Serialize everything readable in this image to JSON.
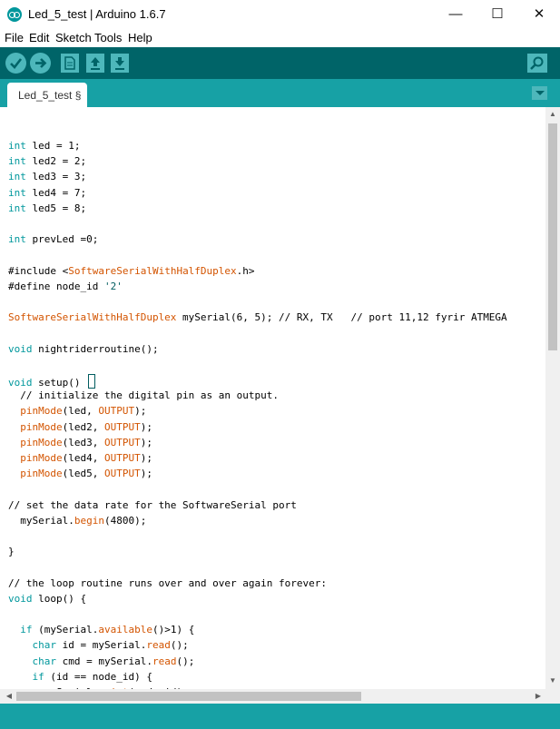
{
  "window": {
    "title": "Led_5_test | Arduino 1.6.7",
    "minimize": "—",
    "maximize": "☐",
    "close": "✕"
  },
  "menu": {
    "items": [
      "File",
      "Edit",
      "Sketch",
      "Tools",
      "Help"
    ]
  },
  "toolbar": {
    "verify_icon": "checkmark-icon",
    "upload_icon": "arrow-right-icon",
    "new_icon": "new-file-icon",
    "open_icon": "arrow-up-icon",
    "save_icon": "arrow-down-icon",
    "serial_icon": "magnifier-icon"
  },
  "tabs": [
    {
      "label": "Led_5_test §"
    }
  ],
  "editor": {
    "lines": [
      "int led = 1;",
      "int led2 = 2;",
      "int led3 = 3;",
      "int led4 = 7;",
      "int led5 = 8;",
      "",
      "int prevLed =0;",
      "",
      "#include <SoftwareSerialWithHalfDuplex.h>",
      "#define node_id '2'",
      "",
      "SoftwareSerialWithHalfDuplex mySerial(6, 5); // RX, TX   // port 11,12 fyrir ATMEGA",
      "",
      "void nightriderroutine();",
      "",
      "void setup() ",
      "  // initialize the digital pin as an output.",
      "  pinMode(led, OUTPUT);",
      "  pinMode(led2, OUTPUT);",
      "  pinMode(led3, OUTPUT);",
      "  pinMode(led4, OUTPUT);",
      "  pinMode(led5, OUTPUT);",
      "",
      "// set the data rate for the SoftwareSerial port",
      "  mySerial.begin(4800);",
      "",
      "}",
      "",
      "// the loop routine runs over and over again forever:",
      "void loop() {",
      "",
      "  if (mySerial.available()>1) {",
      "    char id = mySerial.read();",
      "    char cmd = mySerial.read();",
      "    if (id == node_id) {",
      "      mySerial.print(node_id);"
    ]
  }
}
